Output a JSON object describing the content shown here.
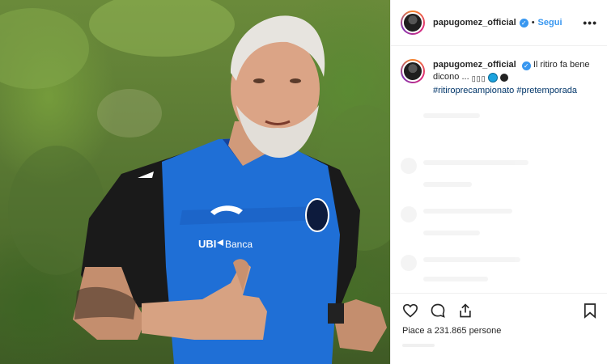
{
  "post": {
    "username": "papugomez_official",
    "follow_label": "Segui",
    "separator": "•",
    "more_label": "•••"
  },
  "caption": {
    "username": "papugomez_official",
    "text": "Il ritiro fa bene dicono ...",
    "emoji_boxes": "▯▯▯",
    "hashtag1": "#ritiroprecampionato",
    "hashtag2": "#pretemporada"
  },
  "photo": {
    "jersey_sponsor": "UBI",
    "jersey_sponsor2": "Banca",
    "jersey_brand_mark": "joma"
  },
  "footer": {
    "likes_text": "Piace a 231.865 persone"
  },
  "colors": {
    "link": "#3897f0",
    "hashtag": "#003569",
    "jersey_blue": "#1f6fd6"
  }
}
